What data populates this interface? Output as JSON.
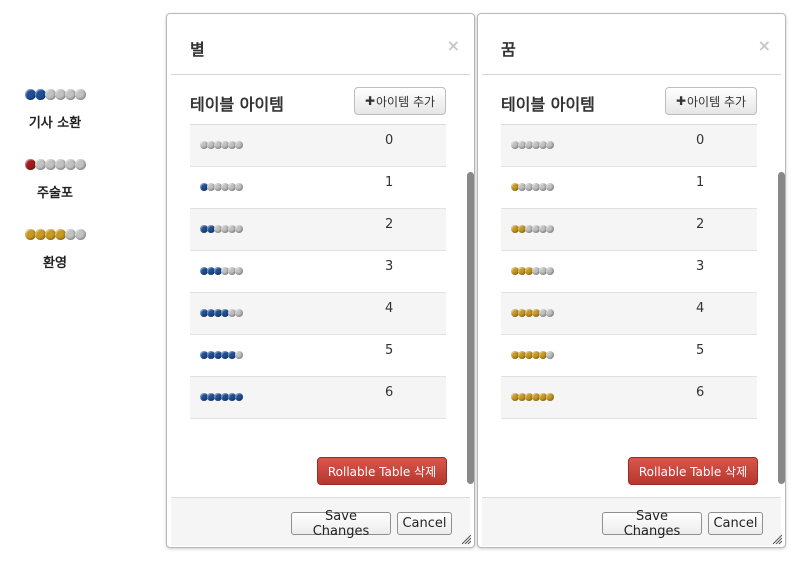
{
  "colors": {
    "blue": "#1f4f96",
    "red": "#a11d1d",
    "gold": "#c99a21",
    "gray": "#c2c2c2",
    "delete_button": "#c0463c"
  },
  "sidebar": {
    "items": [
      {
        "label": "기사 소환",
        "filled": 2,
        "total": 6,
        "color": "blue"
      },
      {
        "label": "주술포",
        "filled": 1,
        "total": 6,
        "color": "red"
      },
      {
        "label": "환영",
        "filled": 4,
        "total": 6,
        "color": "gold"
      }
    ]
  },
  "dialogs": [
    {
      "title": "별",
      "close_icon": "×",
      "section_title": "테이블 아이템",
      "add_button": {
        "plus": "✚",
        "label": "아이템 추가"
      },
      "dot_color": "blue",
      "rows": [
        {
          "filled": 0,
          "value": "0"
        },
        {
          "filled": 1,
          "value": "1"
        },
        {
          "filled": 2,
          "value": "2"
        },
        {
          "filled": 3,
          "value": "3"
        },
        {
          "filled": 4,
          "value": "4"
        },
        {
          "filled": 5,
          "value": "5"
        },
        {
          "filled": 6,
          "value": "6"
        }
      ],
      "delete_button": "Rollable Table 삭제",
      "save_button": "Save Changes",
      "cancel_button": "Cancel"
    },
    {
      "title": "꿈",
      "close_icon": "×",
      "section_title": "테이블 아이템",
      "add_button": {
        "plus": "✚",
        "label": "아이템 추가"
      },
      "dot_color": "gold",
      "rows": [
        {
          "filled": 0,
          "value": "0"
        },
        {
          "filled": 1,
          "value": "1"
        },
        {
          "filled": 2,
          "value": "2"
        },
        {
          "filled": 3,
          "value": "3"
        },
        {
          "filled": 4,
          "value": "4"
        },
        {
          "filled": 5,
          "value": "5"
        },
        {
          "filled": 6,
          "value": "6"
        }
      ],
      "delete_button": "Rollable Table 삭제",
      "save_button": "Save Changes",
      "cancel_button": "Cancel"
    }
  ]
}
